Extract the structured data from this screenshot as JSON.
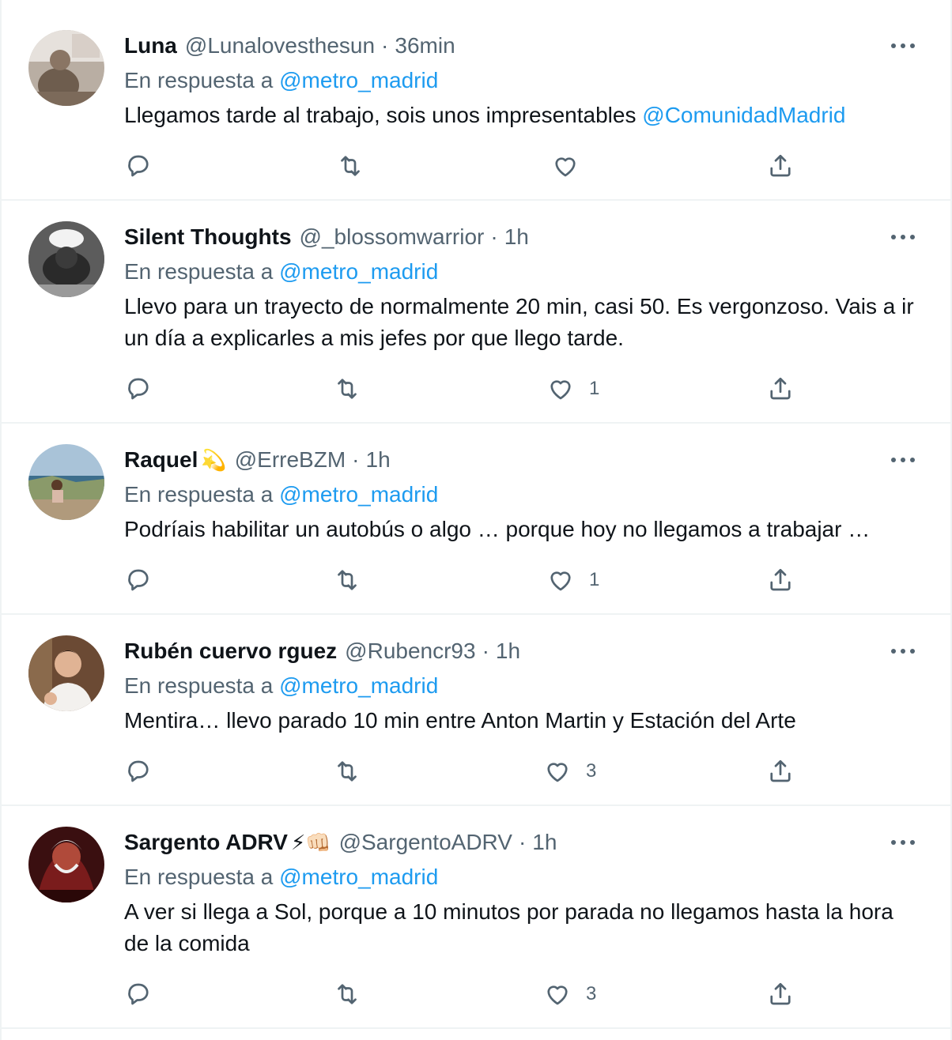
{
  "tweets": [
    {
      "name": "Luna",
      "badge": "",
      "handle": "@Lunalovesthesun",
      "separator": "·",
      "time": "36min",
      "reply_prefix": "En respuesta a",
      "reply_mention": "@metro_madrid",
      "text_parts": [
        "Llegamos tarde al trabajo, sois unos impresentables ",
        "@ComunidadMadrid"
      ],
      "like_count": ""
    },
    {
      "name": "Silent Thoughts",
      "badge": "",
      "handle": "@_blossomwarrior",
      "separator": "·",
      "time": "1h",
      "reply_prefix": "En respuesta a",
      "reply_mention": "@metro_madrid",
      "text_parts": [
        "Llevo para un trayecto de normalmente 20 min, casi 50. Es vergonzoso. Vais a ir un día a explicarles a mis jefes por que llego tarde."
      ],
      "like_count": "1"
    },
    {
      "name": "Raquel",
      "badge": "💫",
      "handle": "@ErreBZM",
      "separator": "·",
      "time": "1h",
      "reply_prefix": "En respuesta a",
      "reply_mention": "@metro_madrid",
      "text_parts": [
        "Podríais habilitar un autobús o algo … porque hoy no llegamos a trabajar …"
      ],
      "like_count": "1"
    },
    {
      "name": "Rubén cuervo rguez",
      "badge": "",
      "handle": "@Rubencr93",
      "separator": "·",
      "time": "1h",
      "reply_prefix": "En respuesta a",
      "reply_mention": "@metro_madrid",
      "text_parts": [
        "Mentira… llevo parado 10 min entre Anton Martin y Estación del Arte"
      ],
      "like_count": "3"
    },
    {
      "name": "Sargento ADRV",
      "badge": "⚡👊🏻",
      "handle": "@SargentoADRV",
      "separator": "·",
      "time": "1h",
      "reply_prefix": "En respuesta a",
      "reply_mention": "@metro_madrid",
      "text_parts": [
        "A ver si llega a Sol, porque a 10 minutos por parada no llegamos hasta la hora de la comida"
      ],
      "like_count": "3"
    }
  ],
  "icons": {
    "reply": "reply-icon",
    "retweet": "retweet-icon",
    "like": "like-icon",
    "share": "share-icon",
    "more": "more-icon"
  },
  "colors": {
    "link": "#1d9bf0",
    "secondary_text": "#536471",
    "primary_text": "#0f1419",
    "divider": "#eff3f4"
  }
}
